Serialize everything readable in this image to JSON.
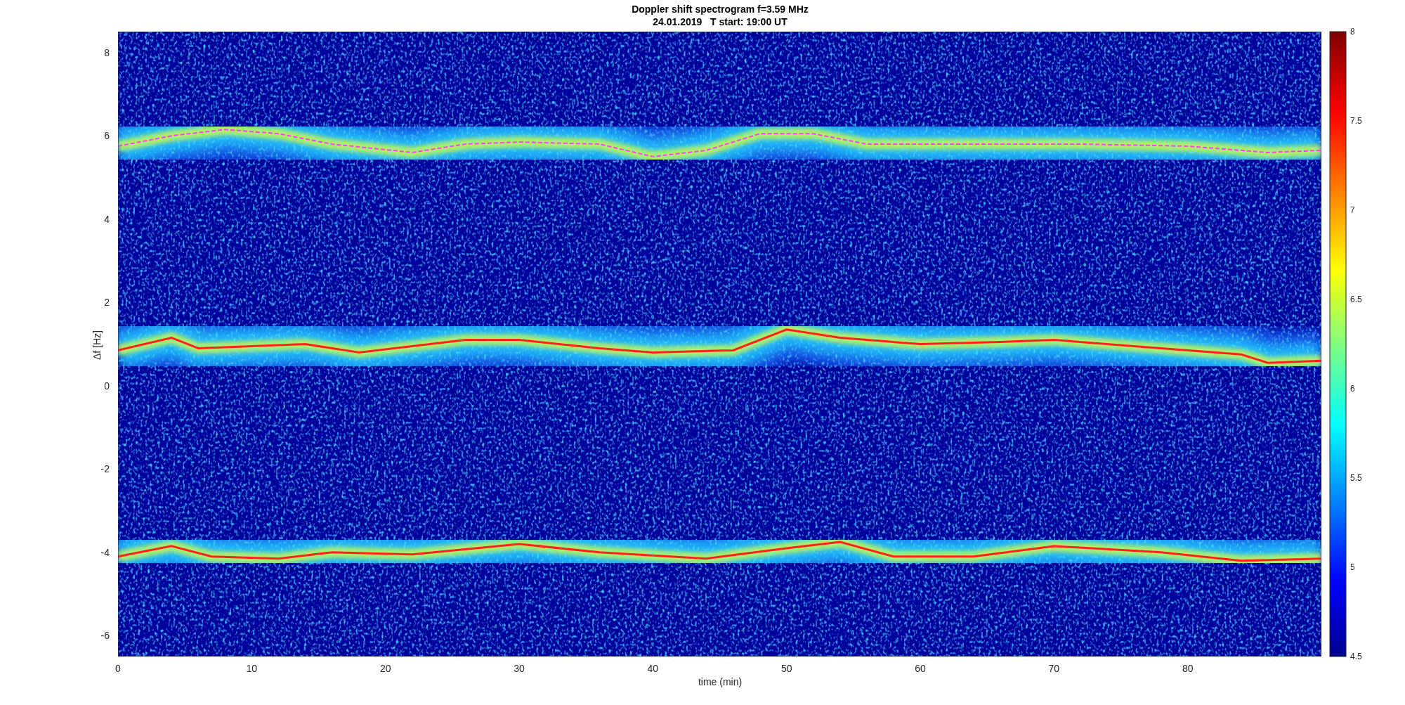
{
  "figure": {
    "title": "Doppler shift spectrogram f=3.59 MHz",
    "subtitle": "24.01.2019   T start: 19:00 UT"
  },
  "axes": {
    "xlabel": "time (min)",
    "ylabel": "Δf [Hz]",
    "xticks": [
      "0",
      "10",
      "20",
      "30",
      "40",
      "50",
      "60",
      "70",
      "80"
    ],
    "yticks": [
      "8",
      "6",
      "4",
      "2",
      "0",
      "-2",
      "-4",
      "-6"
    ]
  },
  "colorbar": {
    "ticks": [
      "8",
      "7.5",
      "7",
      "6.5",
      "6",
      "5.5",
      "5",
      "4.5"
    ]
  }
}
